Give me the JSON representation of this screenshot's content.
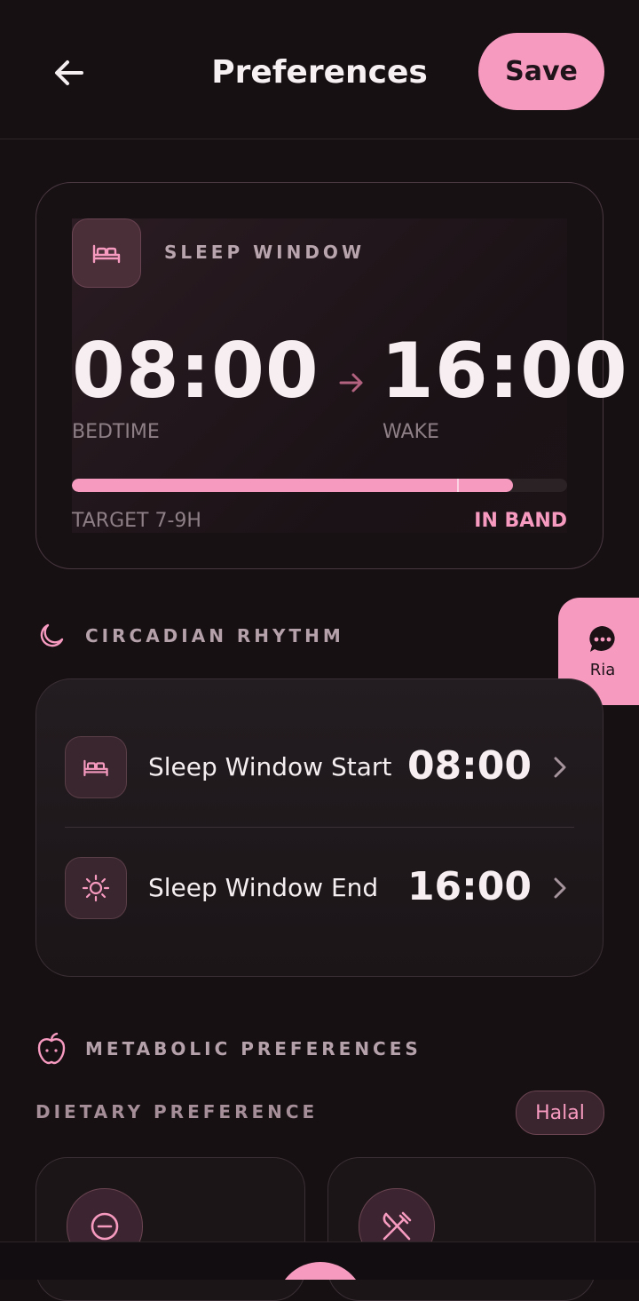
{
  "header": {
    "title": "Preferences",
    "save_label": "Save"
  },
  "sleep_window": {
    "label": "SLEEP WINDOW",
    "bedtime": "08:00",
    "wake": "16:00",
    "bedtime_label": "BEDTIME",
    "wake_label": "WAKE",
    "progress_fraction": 0.89,
    "target_label": "TARGET 7-9H",
    "status": "IN BAND"
  },
  "circadian": {
    "title": "CIRCADIAN RHYTHM",
    "rows": [
      {
        "label": "Sleep Window Start",
        "value": "08:00",
        "icon": "bed-icon"
      },
      {
        "label": "Sleep Window End",
        "value": "16:00",
        "icon": "sun-icon"
      }
    ]
  },
  "assistant": {
    "label": "Ria",
    "icon": "chat-bubble-icon"
  },
  "metabolic": {
    "title": "METABOLIC PREFERENCES",
    "dietary_label": "DIETARY PREFERENCE",
    "dietary_value": "Halal",
    "options": [
      {
        "icon": "minus-circle-icon"
      },
      {
        "icon": "utensils-crossed-icon"
      }
    ]
  },
  "colors": {
    "accent": "#f79ac0",
    "background": "#161013",
    "muted_text": "#8d7f85"
  }
}
